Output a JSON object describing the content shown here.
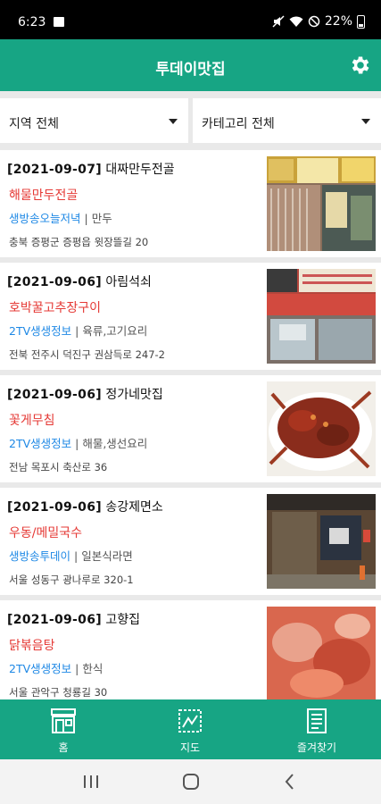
{
  "status_bar": {
    "time": "6:23",
    "battery": "22%"
  },
  "app_bar": {
    "title": "투데이맛집"
  },
  "filters": {
    "region": "지역 전체",
    "category": "카테고리 전체"
  },
  "restaurants": [
    {
      "date": "[2021-09-07]",
      "name": "대짜만두전골",
      "menu": "해물만두전골",
      "program": "생방송오늘저녁",
      "category": "만두",
      "address": "충북 증평군 증평읍 윗장뜰길 20"
    },
    {
      "date": "[2021-09-06]",
      "name": "아림석쇠",
      "menu": "호박꿀고추장구이",
      "program": "2TV생생정보",
      "category": "육류,고기요리",
      "address": "전북 전주시 덕진구 권삼득로 247-2"
    },
    {
      "date": "[2021-09-06]",
      "name": "정가네맛집",
      "menu": "꽃게무침",
      "program": "2TV생생정보",
      "category": "해물,생선요리",
      "address": "전남 목포시 축산로 36"
    },
    {
      "date": "[2021-09-06]",
      "name": "송강제면소",
      "menu": "우동/메밀국수",
      "program": "생방송투데이",
      "category": "일본식라면",
      "address": "서울 성동구 광나루로 320-1"
    },
    {
      "date": "[2021-09-06]",
      "name": "고향집",
      "menu": "닭볶음탕",
      "program": "2TV생생정보",
      "category": "한식",
      "address": "서울 관악구 청룡길 30"
    }
  ],
  "bottom_nav": {
    "home": "홈",
    "map": "지도",
    "favorites": "즐겨찾기"
  },
  "colors": {
    "primary": "#17a584",
    "menu_red": "#e53935",
    "program_blue": "#1e88e5"
  }
}
